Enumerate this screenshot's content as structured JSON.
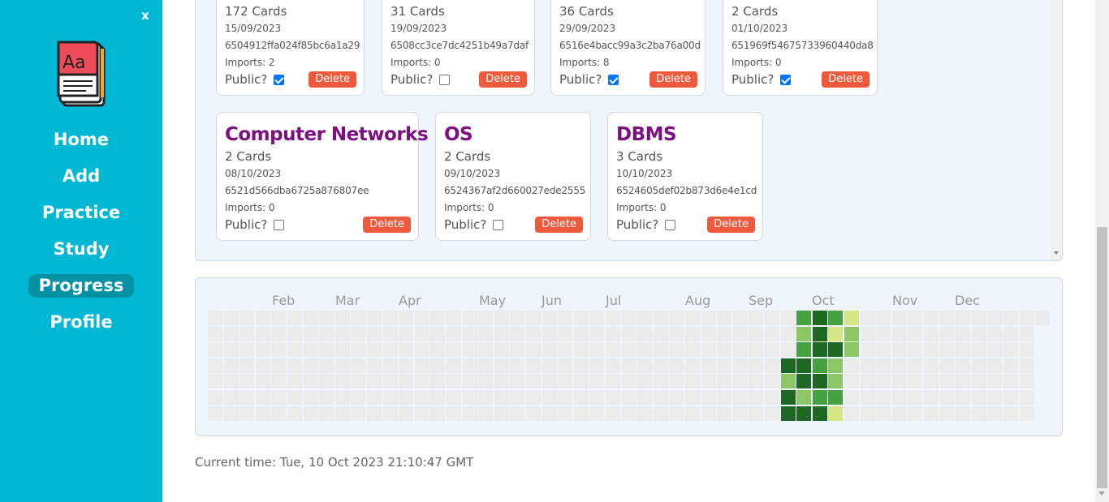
{
  "sidebar": {
    "close_label": "x",
    "nav": [
      {
        "label": "Home",
        "active": false
      },
      {
        "label": "Add",
        "active": false
      },
      {
        "label": "Practice",
        "active": false
      },
      {
        "label": "Study",
        "active": false
      },
      {
        "label": "Progress",
        "active": true
      },
      {
        "label": "Profile",
        "active": false
      }
    ]
  },
  "decks": [
    {
      "cards": "172 Cards",
      "date": "15/09/2023",
      "id": "6504912ffa024f85bc6a1a29",
      "imports": "Imports: 2",
      "public_label": "Public?",
      "public": true,
      "delete_label": "Delete"
    },
    {
      "cards": "31 Cards",
      "date": "19/09/2023",
      "id": "6508cc3ce7dc4251b49a7daf",
      "imports": "Imports: 0",
      "public_label": "Public?",
      "public": false,
      "delete_label": "Delete"
    },
    {
      "cards": "36 Cards",
      "date": "29/09/2023",
      "id": "6516e4bacc99a3c2ba76a00d",
      "imports": "Imports: 8",
      "public_label": "Public?",
      "public": true,
      "delete_label": "Delete"
    },
    {
      "cards": "2 Cards",
      "date": "01/10/2023",
      "id": "651969f54675733960440da8",
      "imports": "Imports: 0",
      "public_label": "Public?",
      "public": true,
      "delete_label": "Delete"
    },
    {
      "title": "Computer Networks",
      "cards": "2 Cards",
      "date": "08/10/2023",
      "id": "6521d566dba6725a876807ee",
      "imports": "Imports: 0",
      "public_label": "Public?",
      "public": false,
      "delete_label": "Delete"
    },
    {
      "title": "OS",
      "cards": "2 Cards",
      "date": "09/10/2023",
      "id": "6524367af2d660027ede2555",
      "imports": "Imports: 0",
      "public_label": "Public?",
      "public": false,
      "delete_label": "Delete"
    },
    {
      "title": "DBMS",
      "cards": "3 Cards",
      "date": "10/10/2023",
      "id": "6524605def02b873d6e4e1cd",
      "imports": "Imports: 0",
      "public_label": "Public?",
      "public": false,
      "delete_label": "Delete"
    }
  ],
  "heatmap": {
    "months": [
      "Feb",
      "Mar",
      "Apr",
      "May",
      "Jun",
      "Jul",
      "Aug",
      "Sep",
      "Oct",
      "Nov",
      "Dec"
    ],
    "colors": {
      "empty": "#ebebeb",
      "l1": "#d6e685",
      "l2": "#8cc665",
      "l3": "#44a340",
      "l4": "#1e6823"
    },
    "active_weeks": [
      {
        "week": 36,
        "levels": [
          0,
          0,
          0,
          4,
          2,
          4,
          4
        ]
      },
      {
        "week": 37,
        "levels": [
          3,
          2,
          3,
          4,
          4,
          2,
          4
        ]
      },
      {
        "week": 38,
        "levels": [
          4,
          4,
          4,
          3,
          4,
          3,
          4
        ]
      },
      {
        "week": 39,
        "levels": [
          3,
          1,
          4,
          2,
          2,
          3,
          1
        ]
      },
      {
        "week": 40,
        "levels": [
          1,
          2,
          2,
          0,
          0,
          0,
          0
        ]
      }
    ]
  },
  "current_time": "Current time: Tue, 10 Oct 2023 21:10:47 GMT"
}
